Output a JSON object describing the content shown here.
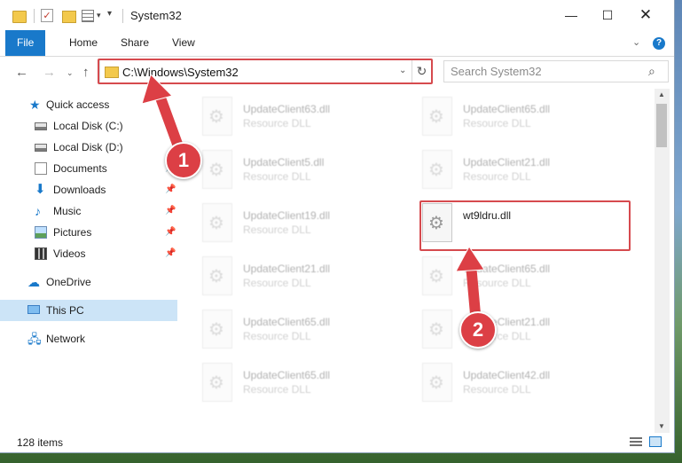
{
  "window": {
    "title": "System32",
    "minimize_glyph": "—",
    "maximize_glyph": "☐",
    "close_glyph": "✕"
  },
  "quick_access_toolbar": {
    "icons": [
      "folder-icon",
      "properties-checkmark-icon",
      "new-folder-icon",
      "properties-icon",
      "dropdown-icon",
      "customize-icon"
    ],
    "check_glyph": "✓",
    "drop_glyph": "▾",
    "more_glyph": "▾"
  },
  "ribbon": {
    "tabs": [
      "File",
      "Home",
      "Share",
      "View"
    ],
    "expand_glyph": "⌄",
    "help_glyph": "?"
  },
  "nav": {
    "back_glyph": "←",
    "forward_glyph": "→",
    "recent_glyph": "⌄",
    "up_glyph": "↑",
    "address": "C:\\Windows\\System32",
    "address_drop_glyph": "⌄",
    "refresh_glyph": "↻",
    "search_placeholder": "Search System32",
    "search_glyph": "⌕"
  },
  "sidebar": {
    "quick_access": "Quick access",
    "items": [
      {
        "label": "Local Disk (C:)",
        "icon": "disk-icon",
        "pinned": false
      },
      {
        "label": "Local Disk (D:)",
        "icon": "disk-icon",
        "pinned": false
      },
      {
        "label": "Documents",
        "icon": "documents-icon",
        "pinned": true
      },
      {
        "label": "Downloads",
        "icon": "downloads-icon",
        "pinned": true
      },
      {
        "label": "Music",
        "icon": "music-icon",
        "pinned": true
      },
      {
        "label": "Pictures",
        "icon": "pictures-icon",
        "pinned": true
      },
      {
        "label": "Videos",
        "icon": "videos-icon",
        "pinned": true
      }
    ],
    "pin_glyph": "📌",
    "onedrive": "OneDrive",
    "this_pc": "This PC",
    "network": "Network"
  },
  "files": [
    {
      "name": "UpdateClient63.dll",
      "type": "Resource DLL",
      "faded": true
    },
    {
      "name": "UpdateClient65.dll",
      "type": "Resource DLL",
      "faded": true
    },
    {
      "name": "UpdateClient5.dll",
      "type": "Resource DLL",
      "faded": true
    },
    {
      "name": "UpdateClient21.dll",
      "type": "Resource DLL",
      "faded": true
    },
    {
      "name": "UpdateClient19.dll",
      "type": "Resource DLL",
      "faded": true
    },
    {
      "name": "wt9ldru.dll",
      "type": "",
      "faded": false
    },
    {
      "name": "UpdateClient21.dll",
      "type": "Resource DLL",
      "faded": true
    },
    {
      "name": "UpdateClient65.dll",
      "type": "Resource DLL",
      "faded": true
    },
    {
      "name": "UpdateClient65.dll",
      "type": "Resource DLL",
      "faded": true
    },
    {
      "name": "UpdateClient21.dll",
      "type": "Resource DLL",
      "faded": true
    },
    {
      "name": "UpdateClient65.dll",
      "type": "Resource DLL",
      "faded": true
    },
    {
      "name": "UpdateClient42.dll",
      "type": "Resource DLL",
      "faded": true
    }
  ],
  "gear_glyph": "⚙",
  "status": {
    "item_count": "128 items"
  },
  "callouts": {
    "step1": "1",
    "step2": "2",
    "color": "#dc3f45"
  },
  "colors": {
    "accent": "#1979ca",
    "selection": "#cce4f7",
    "highlight": "#d64a4e"
  }
}
